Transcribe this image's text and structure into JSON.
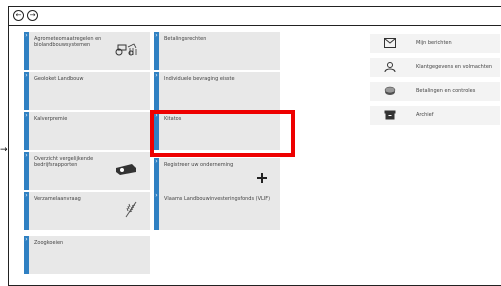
{
  "nav": {
    "back_label": "←",
    "forward_label": "→"
  },
  "tiles": [
    {
      "label": "Agrometeomaatregelen en biolandbouwsystemen",
      "icon": "tractor-icon"
    },
    {
      "label": "Betalingsrechten",
      "icon": ""
    },
    {
      "label": "Geoloket Landbouw",
      "icon": ""
    },
    {
      "label": "Individuele bevraging eisste",
      "icon": ""
    },
    {
      "label": "Kalverpremie",
      "icon": ""
    },
    {
      "label": "Kitatos",
      "icon": ""
    },
    {
      "label": "Overzicht vergelijkende bedrijfsrapporten",
      "icon": "projector-icon"
    },
    {
      "label": "Registreer uw onderneming",
      "icon": "plus-icon"
    },
    {
      "label": "Verzamelaanvraag",
      "icon": "wheat-icon"
    },
    {
      "label": "Vlaams Landbouwinvesteringsfonds (VLIF)",
      "icon": ""
    },
    {
      "label": "Zoogkoeien",
      "icon": ""
    }
  ],
  "side_menu": [
    {
      "label": "Mijn berichten",
      "icon": "envelope-icon"
    },
    {
      "label": "Klantgegevens en volmachten",
      "icon": "user-icon"
    },
    {
      "label": "Betalingen en controles",
      "icon": "coins-icon"
    },
    {
      "label": "Archief",
      "icon": "archive-icon"
    }
  ],
  "annotation": {
    "arrow_glyph": "→"
  },
  "colors": {
    "stripe": "#2f80c2",
    "tile_bg": "#e8e8e8",
    "highlight": "#e00000"
  }
}
